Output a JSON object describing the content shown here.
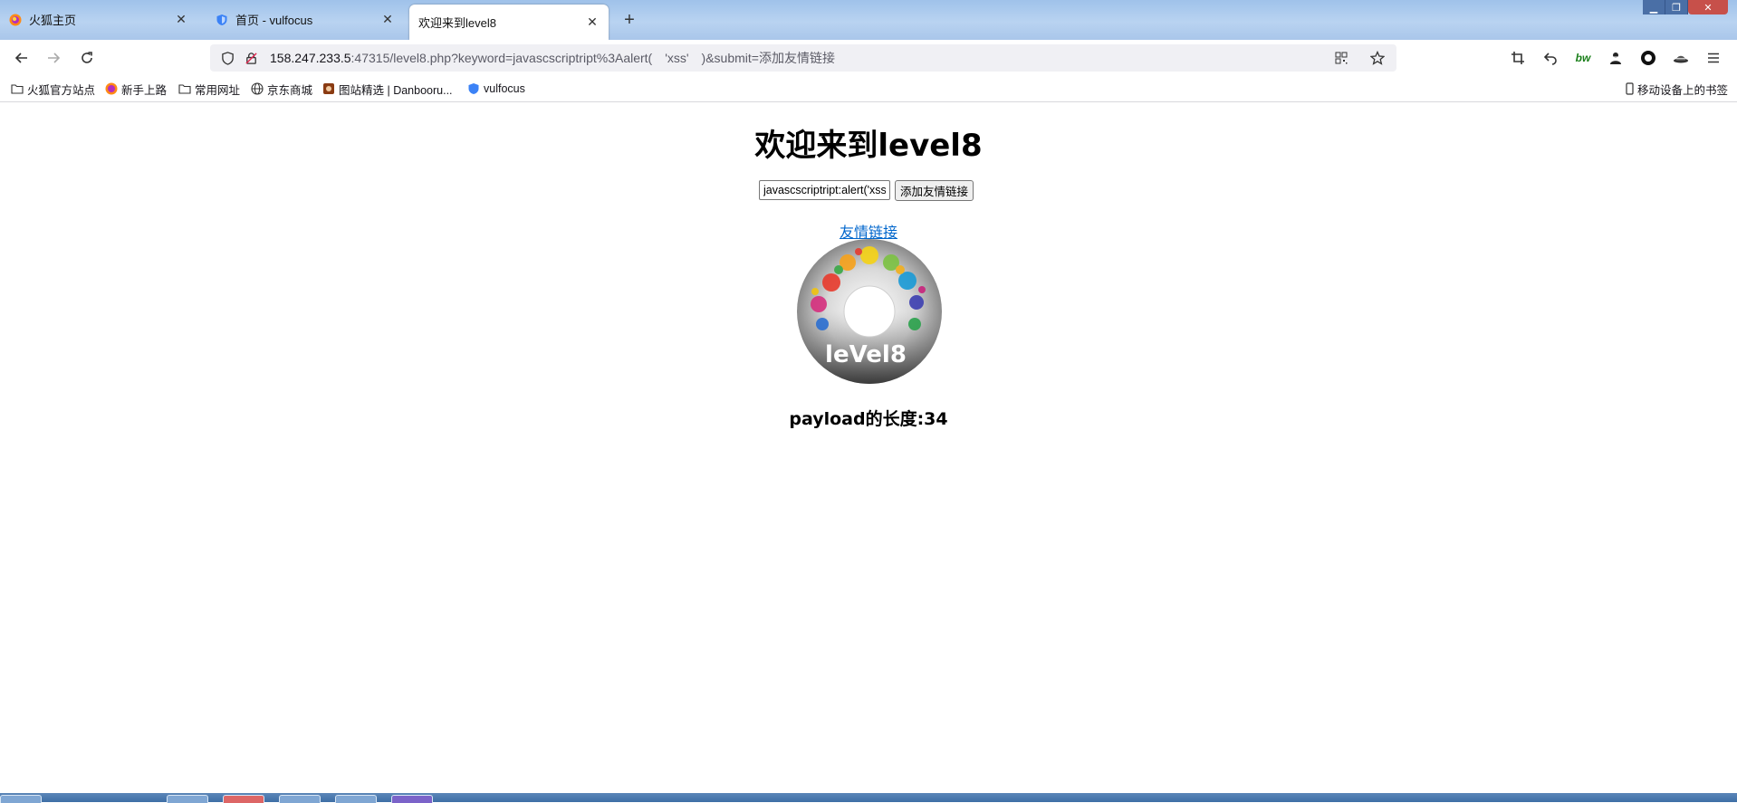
{
  "tabs": [
    {
      "title": "火狐主页",
      "icon": "firefox-icon",
      "active": false
    },
    {
      "title": "首页 - vulfocus",
      "icon": "shield-icon",
      "active": false
    },
    {
      "title": "欢迎来到level8",
      "icon": "",
      "active": true
    }
  ],
  "address": {
    "host": "158.247.233.5",
    "rest": ":47315/level8.php?keyword=javascscriptript%3Aalert(　'xss'　)&submit=添加友情链接"
  },
  "bookmarks": [
    {
      "label": "火狐官方站点",
      "icon": "folder-icon"
    },
    {
      "label": "新手上路",
      "icon": "firefox-icon"
    },
    {
      "label": "常用网址",
      "icon": "folder-icon"
    },
    {
      "label": "京东商城",
      "icon": "globe-icon"
    },
    {
      "label": "图站精选 | Danbooru...",
      "icon": "image-icon"
    },
    {
      "label": "vulfocus",
      "icon": "shield-icon"
    }
  ],
  "mobile_bookmarks": "移动设备上的书签",
  "page": {
    "heading": "欢迎来到level8",
    "keyword_value": "javascscriptript:alert('xss')",
    "submit_label": "添加友情链接",
    "friend_link": "友情链接",
    "logo_text": "leVel8",
    "payload_length": "payload的长度:34"
  },
  "colors": {
    "link": "#0066cc",
    "tabstrip": "#b9d3f1"
  }
}
